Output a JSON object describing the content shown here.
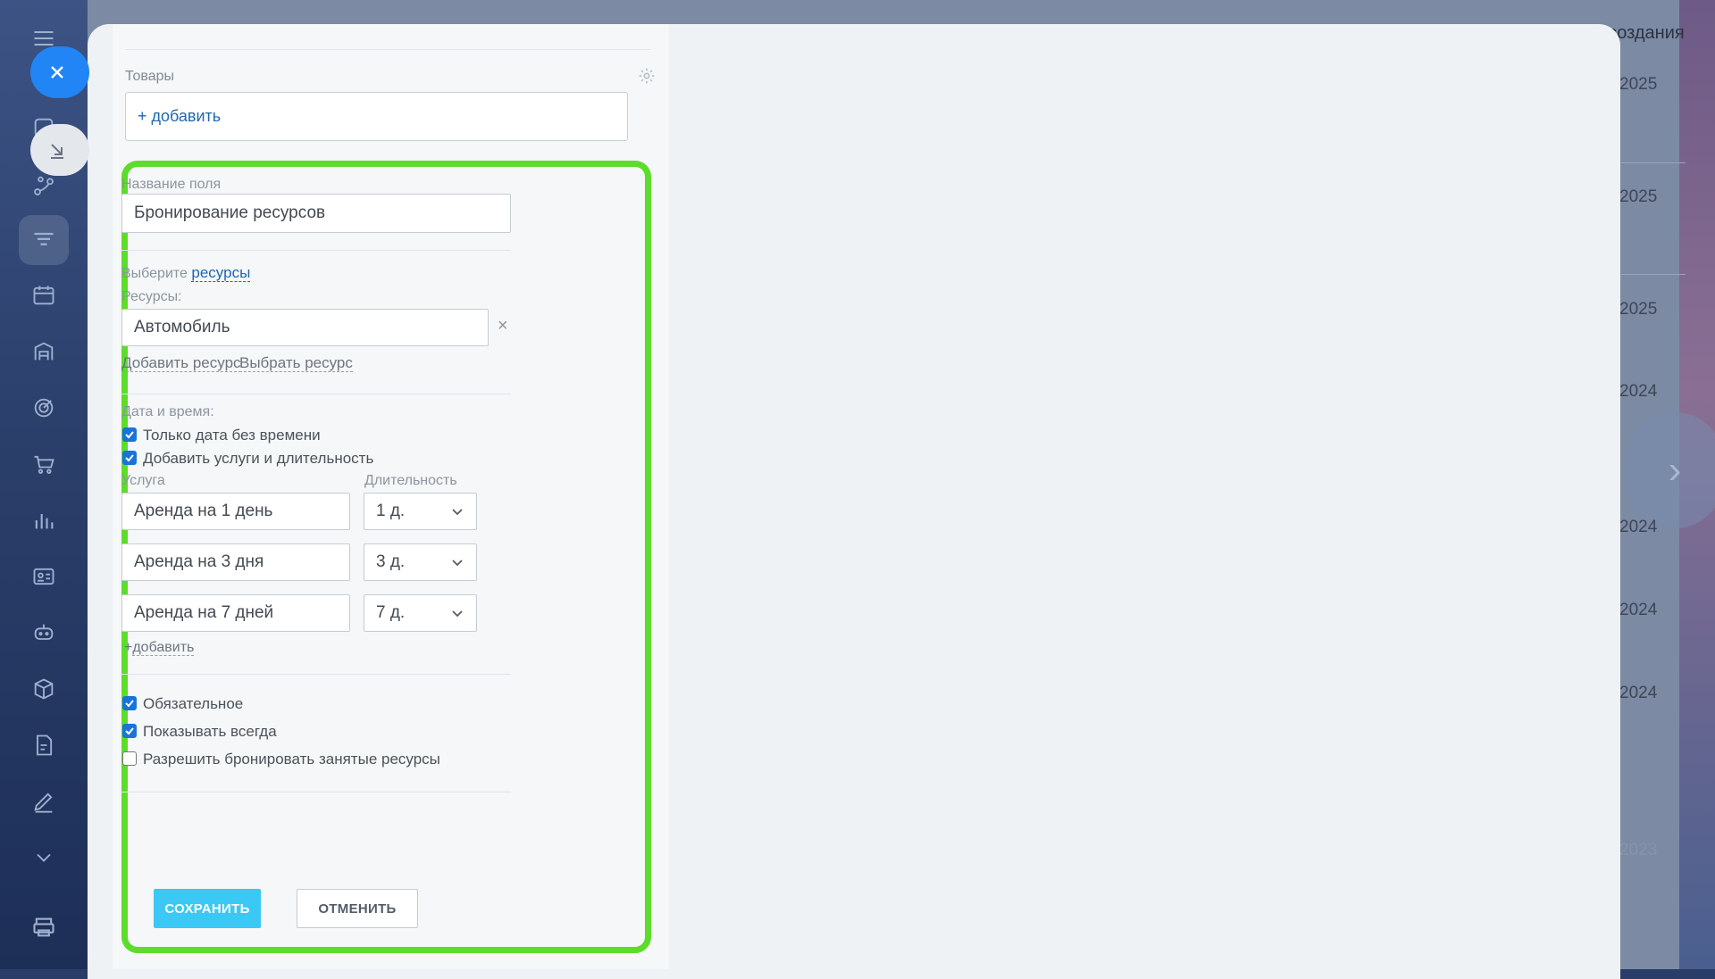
{
  "background": {
    "column_header": "создания",
    "years": [
      "2025",
      "2025",
      "2025",
      "2024",
      "2024",
      "2024",
      "2024",
      "2023"
    ]
  },
  "form": {
    "goods_label": "Товары",
    "goods_add": "+ добавить",
    "field_name_label": "Название поля",
    "field_name_value": "Бронирование ресурсов",
    "choose_prefix": "Выберите",
    "choose_link": "ресурсы",
    "resources_label": "Ресурсы:",
    "resource_value": "Автомобиль",
    "add_resource": "Добавить ресурс",
    "pick_resource": "Выбрать ресурс",
    "datetime_label": "Дата и время:",
    "checkboxes_top": [
      {
        "label": "Только дата без времени",
        "checked": true
      },
      {
        "label": "Добавить услуги и длительность",
        "checked": true
      }
    ],
    "service_header": "Услуга",
    "duration_header": "Длительность",
    "services": [
      {
        "name": "Аренда на 1 день",
        "duration": "1 д."
      },
      {
        "name": "Аренда на 3 дня",
        "duration": "3 д."
      },
      {
        "name": "Аренда на 7 дней",
        "duration": "7 д."
      }
    ],
    "add_service": "добавить",
    "checkboxes_bottom": [
      {
        "label": "Обязательное",
        "checked": true
      },
      {
        "label": "Показывать всегда",
        "checked": true
      },
      {
        "label": "Разрешить бронировать занятые ресурсы",
        "checked": false
      }
    ],
    "save_label": "СОХРАНИТЬ",
    "cancel_label": "ОТМЕНИТЬ"
  },
  "colors": {
    "highlight_frame": "#5ddc2c",
    "save_button": "#3bc8f5",
    "link": "#2067b0",
    "checkbox_checked": "#1a73d9"
  }
}
